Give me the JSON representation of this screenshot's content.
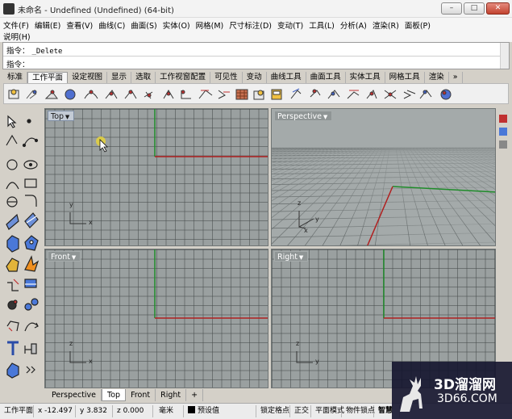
{
  "window": {
    "title": "未命名 - Undefined (Undefined) (64-bit)",
    "minimize": "–",
    "maximize": "□",
    "close": "✕"
  },
  "menu": {
    "row1": [
      "文件(F)",
      "编辑(E)",
      "查看(V)",
      "曲线(C)",
      "曲面(S)",
      "实体(O)",
      "网格(M)",
      "尺寸标注(D)",
      "变动(T)",
      "工具(L)",
      "分析(A)",
      "渲染(R)",
      "面板(P)"
    ],
    "row2": [
      "说明(H)"
    ]
  },
  "command": {
    "line1_label": "指令：",
    "line1_value": "_Delete",
    "line2_label": "指令："
  },
  "toolbar_tabs": [
    "标准",
    "工作平面",
    "设定视图",
    "显示",
    "选取",
    "工作视窗配置",
    "可见性",
    "变动",
    "曲线工具",
    "曲面工具",
    "实体工具",
    "网格工具",
    "渲染",
    "»"
  ],
  "active_tab": "工作平面",
  "viewports": {
    "top": {
      "label": "Top",
      "x_axis": "x",
      "y_axis": "y"
    },
    "perspective": {
      "label": "Perspective",
      "x_axis": "x",
      "y_axis": "y",
      "z_axis": "z"
    },
    "front": {
      "label": "Front",
      "x_axis": "x",
      "z_axis": "z"
    },
    "right": {
      "label": "Right",
      "y_axis": "y",
      "z_axis": "z"
    }
  },
  "viewport_tabs": [
    "Perspective",
    "Top",
    "Front",
    "Right"
  ],
  "active_viewport_tab": "Top",
  "viewport_tab_add": "+",
  "status": {
    "cplane": "工作平面",
    "x": "x -12.497",
    "y": "y 3.832",
    "z": "z 0.000",
    "units": "毫米",
    "layer": "预设值",
    "grid_snap": "锁定格点",
    "ortho": "正交",
    "planar": "平面模式",
    "osnap": "物件锁点",
    "smarttrack": "智慧"
  },
  "watermark": {
    "line1": "3D溜溜网",
    "line2": "3D66.COM"
  },
  "colors": {
    "viewport_bg": "#9aa0a0",
    "axis_red": "#b02020",
    "axis_green": "#1f8c2a",
    "active_label": "#c3cbd5"
  }
}
